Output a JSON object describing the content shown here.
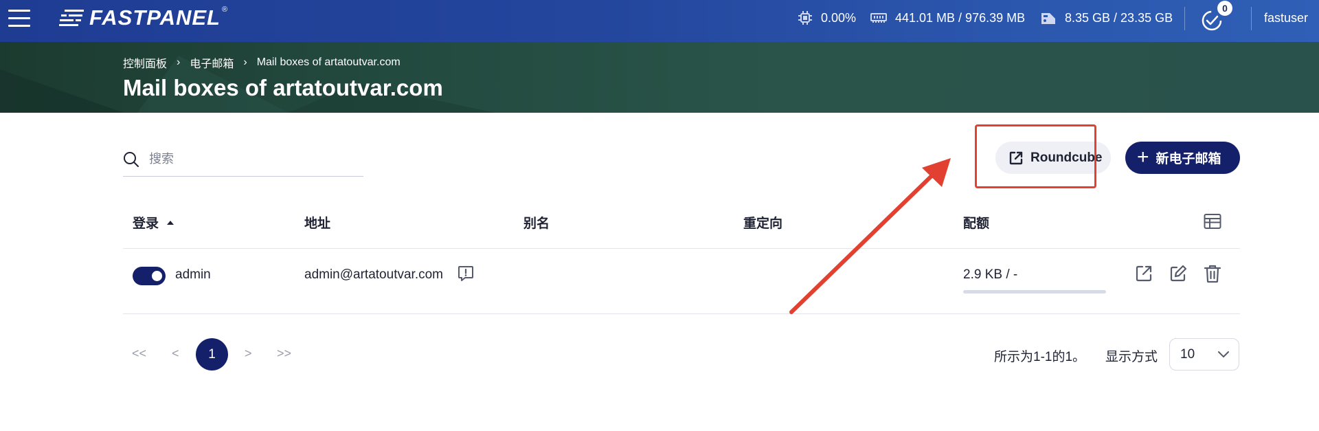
{
  "topbar": {
    "logo_text": "FASTPANEL",
    "logo_reg": "®",
    "cpu": "0.00%",
    "ram": "441.01 MB / 976.39 MB",
    "disk": "8.35 GB / 23.35 GB",
    "tasks_count": "0",
    "username": "fastuser",
    "icons": {
      "menu": "hamburger-icon",
      "cpu": "cpu-icon",
      "ram": "memory-icon",
      "disk": "disk-icon",
      "tasks": "tasks-check-icon"
    }
  },
  "header": {
    "breadcrumb": [
      "控制面板",
      "电子邮箱",
      "Mail boxes of artatoutvar.com"
    ],
    "breadcrumb_sep": "›",
    "title": "Mail boxes of artatoutvar.com"
  },
  "toolbar": {
    "search_placeholder": "搜索",
    "roundcube_label": "Roundcube",
    "new_mailbox_label": "新电子邮箱",
    "new_mailbox_icon": "+"
  },
  "table": {
    "columns": [
      "登录",
      "地址",
      "别名",
      "重定向",
      "配额"
    ],
    "sort_column": "登录",
    "sort_direction": "asc",
    "rows": [
      {
        "enabled": true,
        "login": "admin",
        "address": "admin@artatoutvar.com",
        "alias": "",
        "redirect": "",
        "quota": "2.9 KB / -",
        "quota_fraction": 0
      }
    ]
  },
  "pagination": {
    "first": "<<",
    "prev": "<",
    "current": "1",
    "next": ">",
    "last": ">>",
    "info": "所示为1-1的1。",
    "show_label": "显示方式",
    "page_size": "10"
  },
  "colors": {
    "topbar": "#24469d",
    "header_band": "#234a3f",
    "primary": "#15206a",
    "annotation": "#e24030"
  }
}
